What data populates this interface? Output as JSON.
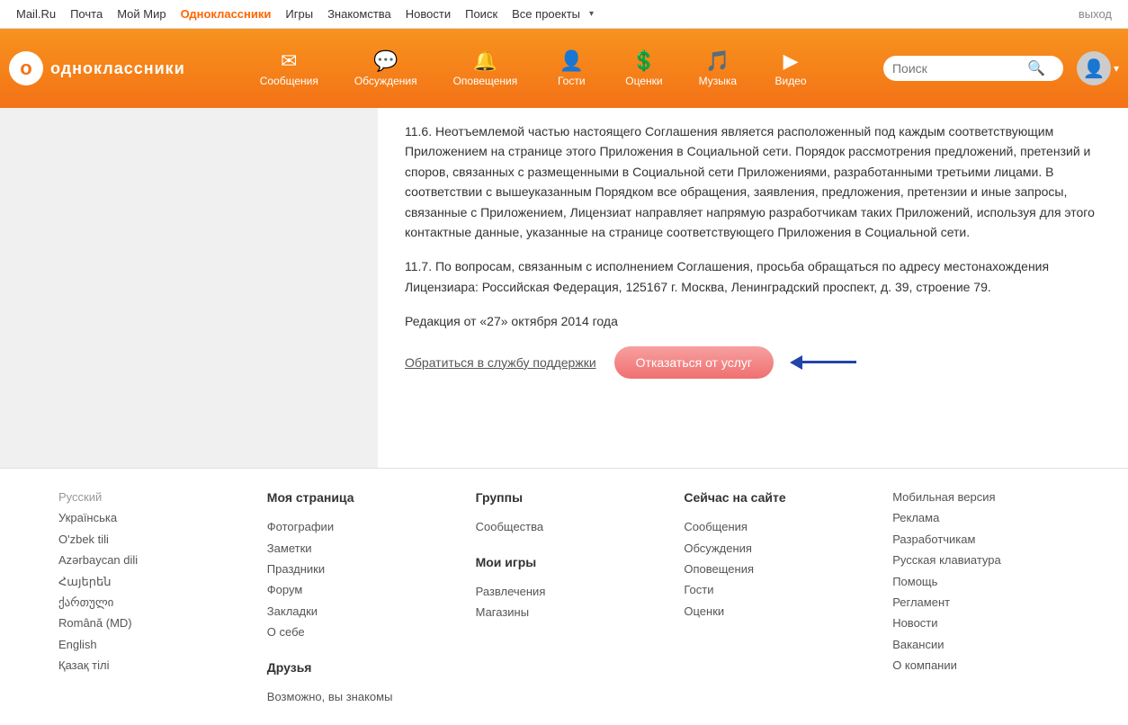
{
  "topnav": {
    "items": [
      {
        "label": "Mail.Ru",
        "active": false
      },
      {
        "label": "Почта",
        "active": false
      },
      {
        "label": "Мой Мир",
        "active": false
      },
      {
        "label": "Одноклассники",
        "active": true
      },
      {
        "label": "Игры",
        "active": false
      },
      {
        "label": "Знакомства",
        "active": false
      },
      {
        "label": "Новости",
        "active": false
      },
      {
        "label": "Поиск",
        "active": false
      },
      {
        "label": "Все проекты",
        "active": false
      }
    ],
    "logout": "выход"
  },
  "header": {
    "logo_text": "одноклассники",
    "search_placeholder": "Поиск",
    "nav_items": [
      {
        "label": "Сообщения",
        "icon": "✉"
      },
      {
        "label": "Обсуждения",
        "icon": "💬"
      },
      {
        "label": "Оповещения",
        "icon": "🔔"
      },
      {
        "label": "Гости",
        "icon": "👥"
      },
      {
        "label": "Оценки",
        "icon": "💰"
      },
      {
        "label": "Музыка",
        "icon": "🎵"
      },
      {
        "label": "Видео",
        "icon": "▶"
      }
    ]
  },
  "main": {
    "paragraphs": [
      "11.6. Неотъемлемой частью настоящего Соглашения является расположенный под каждым соответствующим Приложением на странице этого Приложения в Социальной сети. Порядок рассмотрения предложений, претензий и споров, связанных с размещенными в Социальной сети Приложениями, разработанными третьими лицами. В соответствии с вышеуказанным Порядком все обращения, заявления, предложения, претензии и иные запросы, связанные с Приложением, Лицензиат направляет напрямую разработчикам таких Приложений, используя для этого контактные данные, указанные на странице соответствующего Приложения в Социальной сети.",
      "11.7. По вопросам, связанным с исполнением Соглашения, просьба обращаться по адресу местонахождения Лицензиара: Российская Федерация, 125167 г. Москва, Ленинградский проспект, д. 39, строение 79.",
      "Редакция от «27» октября 2014 года"
    ],
    "support_link": "Обратиться в службу поддержки",
    "cancel_button": "Отказаться от услуг"
  },
  "footer": {
    "languages": {
      "title": "Русский",
      "items": [
        "Українська",
        "O'zbek tili",
        "Azərbaycan dili",
        "Հայերեն",
        "ქართული",
        "Română (MD)",
        "English",
        "Қазақ тілі"
      ]
    },
    "my_page": {
      "title": "Моя страница",
      "items": [
        "Фотографии",
        "Заметки",
        "Праздники",
        "Форум",
        "Закладки",
        "О себе"
      ]
    },
    "groups": {
      "title": "Группы",
      "items": [
        "Сообщества"
      ]
    },
    "my_games": {
      "title": "Мои игры",
      "items": [
        "Развлечения",
        "Магазины"
      ]
    },
    "friends": {
      "title": "Друзья",
      "items": [
        "Возможно, вы знакомы"
      ]
    },
    "now_on_site": {
      "title": "Сейчас на сайте",
      "items": [
        "Сообщения",
        "Обсуждения",
        "Оповещения",
        "Гости",
        "Оценки"
      ]
    },
    "other": {
      "items": [
        "Мобильная версия",
        "Реклама",
        "Разработчикам",
        "Русская клавиатура",
        "Помощь",
        "Регламент",
        "Новости",
        "Вакансии",
        "О компании"
      ]
    }
  }
}
